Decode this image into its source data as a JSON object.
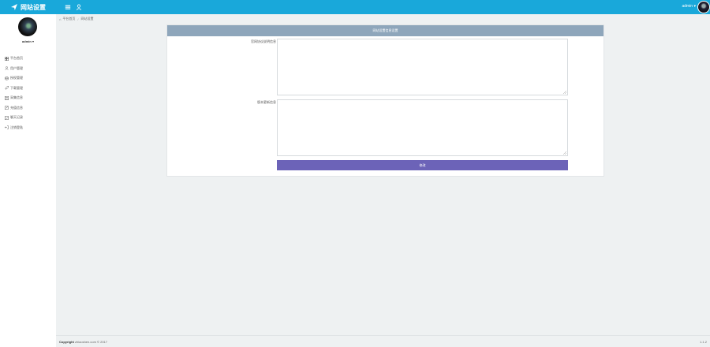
{
  "header": {
    "brand": "网站设置",
    "user": "admin ▾"
  },
  "sidebar": {
    "username": "admin ▾",
    "items": [
      {
        "label": "平台首页",
        "icon": "grid-icon"
      },
      {
        "label": "用户管理",
        "icon": "user-icon"
      },
      {
        "label": "授权管理",
        "icon": "database-icon"
      },
      {
        "label": "下载管理",
        "icon": "rocket-icon"
      },
      {
        "label": "采集信息",
        "icon": "list-icon"
      },
      {
        "label": "充值信息",
        "icon": "edit-icon"
      },
      {
        "label": "聊天记录",
        "icon": "checkbox-icon"
      },
      {
        "label": "注销登陆",
        "icon": "logout-icon"
      }
    ]
  },
  "breadcrumb": {
    "home": "平台首页",
    "current": "网站设置"
  },
  "panel": {
    "title": "网站设置信息设置",
    "field1_label": "官网协议说明信息",
    "field1_value": "",
    "field2_label": "版本更新信息",
    "field2_value": "",
    "submit": "修改"
  },
  "footer": {
    "copyright_label": "Copyright",
    "copyright_text": "zhiaoshen.com © 2017",
    "version": "1.1.2"
  },
  "colors": {
    "topbar": "#19a8da",
    "panel_header": "#8ea6bb",
    "submit": "#6c63b8"
  }
}
